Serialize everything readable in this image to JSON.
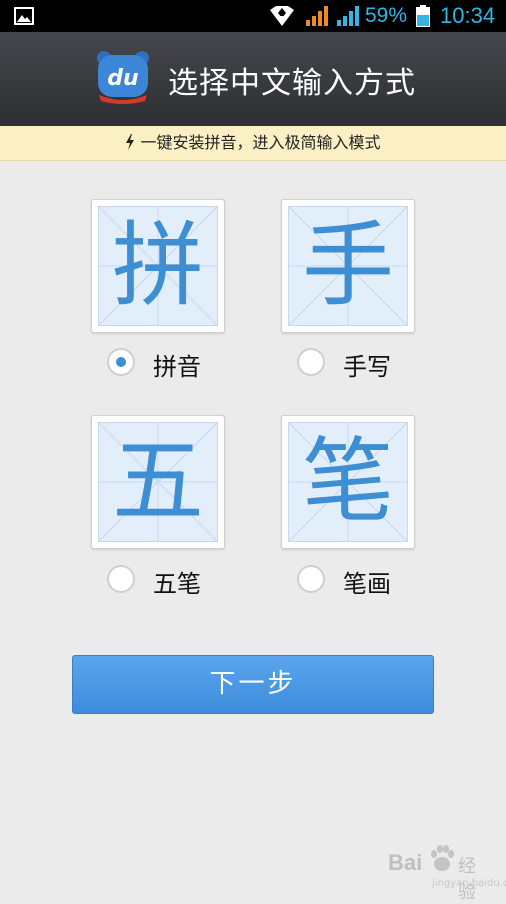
{
  "status_bar": {
    "battery_percent": "59%",
    "time": "10:34",
    "icons": [
      "gallery-icon",
      "wifi-icon",
      "signal-icon",
      "signal-icon",
      "battery-icon"
    ],
    "colors": {
      "accent": "#33b5e5",
      "signal_orange": "#f08a24"
    }
  },
  "header": {
    "logo_text": "du",
    "title": "选择中文输入方式"
  },
  "notice": {
    "icon": "bolt-icon",
    "text": "一键安装拼音，进入极简输入模式"
  },
  "methods": [
    {
      "char": "拼",
      "label": "拼音",
      "selected": true
    },
    {
      "char": "手",
      "label": "手写",
      "selected": false
    },
    {
      "char": "五",
      "label": "五笔",
      "selected": false
    },
    {
      "char": "笔",
      "label": "笔画",
      "selected": false
    }
  ],
  "next_button": {
    "label": "下一步"
  },
  "watermark": {
    "brand": "Bai",
    "sub": "经验",
    "url": "jingyan.baidu.com"
  },
  "colors": {
    "primary_blue": "#3e8ed4",
    "title_bar": "#3a3c40",
    "notice_bg": "#fbf0c4",
    "page_bg": "#ebebeb"
  }
}
